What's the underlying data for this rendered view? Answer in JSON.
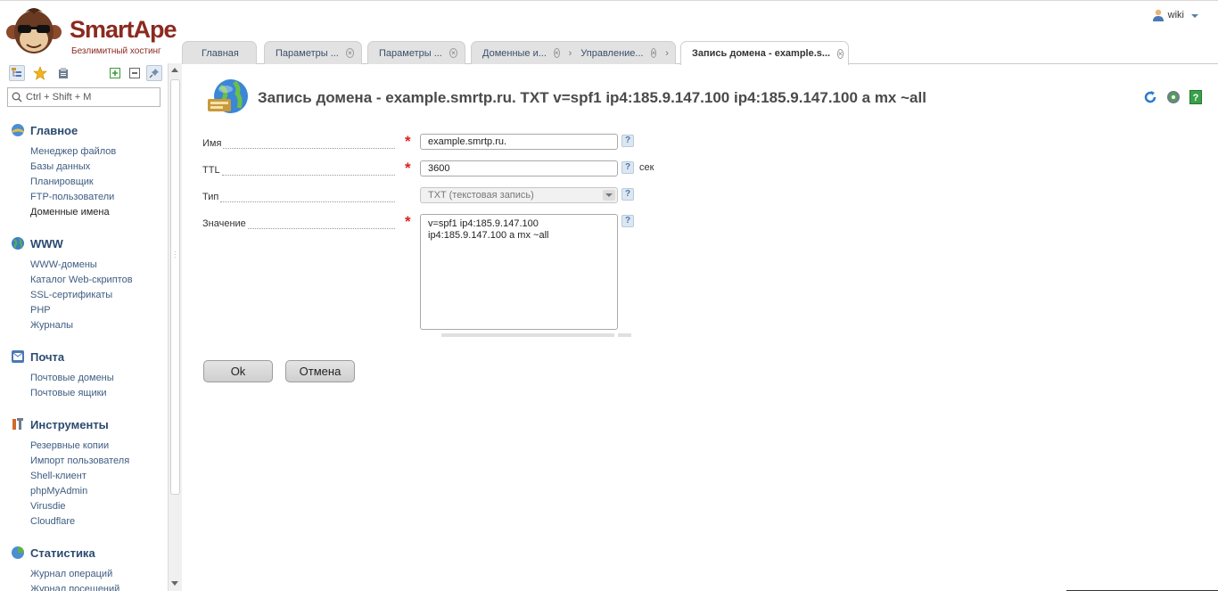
{
  "brand": {
    "name": "SmartApe",
    "tagline": "Безлимитный хостинг"
  },
  "user": {
    "name": "wiki"
  },
  "tabs": [
    {
      "label": "Главная"
    },
    {
      "label": "Параметры ..."
    },
    {
      "label": "Параметры ..."
    },
    {
      "label": "Доменные и..."
    },
    {
      "label": "Управление..."
    },
    {
      "label": "Запись домена - example.s..."
    }
  ],
  "sidebar": {
    "search_placeholder": "Ctrl + Shift + M",
    "groups": [
      {
        "title": "Главное",
        "items": [
          "Менеджер файлов",
          "Базы данных",
          "Планировщик",
          "FTP-пользователи",
          "Доменные имена"
        ]
      },
      {
        "title": "WWW",
        "items": [
          "WWW-домены",
          "Каталог Web-скриптов",
          "SSL-сертификаты",
          "PHP",
          "Журналы"
        ]
      },
      {
        "title": "Почта",
        "items": [
          "Почтовые домены",
          "Почтовые ящики"
        ]
      },
      {
        "title": "Инструменты",
        "items": [
          "Резервные копии",
          "Импорт пользователя",
          "Shell-клиент",
          "phpMyAdmin",
          "Virusdie",
          "Cloudflare"
        ]
      },
      {
        "title": "Статистика",
        "items": [
          "Журнал операций",
          "Журнал посещений"
        ]
      }
    ]
  },
  "page": {
    "title": "Запись домена - example.smrtp.ru. TXT v=spf1 ip4:185.9.147.100 ip4:185.9.147.100 a mx ~all"
  },
  "form": {
    "name": {
      "label": "Имя",
      "value": "example.smrtp.ru."
    },
    "ttl": {
      "label": "TTL",
      "value": "3600",
      "unit": "сек"
    },
    "type": {
      "label": "Тип",
      "value": "TXT (текстовая запись)"
    },
    "value": {
      "label": "Значение",
      "value": "v=spf1 ip4:185.9.147.100 ip4:185.9.147.100 a mx ~all"
    },
    "help_label": "?",
    "required_mark": "*"
  },
  "buttons": {
    "ok": "Ok",
    "cancel": "Отмена"
  },
  "colors": {
    "accent": "#2b4a6f",
    "brand": "#8b2a1f",
    "required": "#e02020"
  }
}
